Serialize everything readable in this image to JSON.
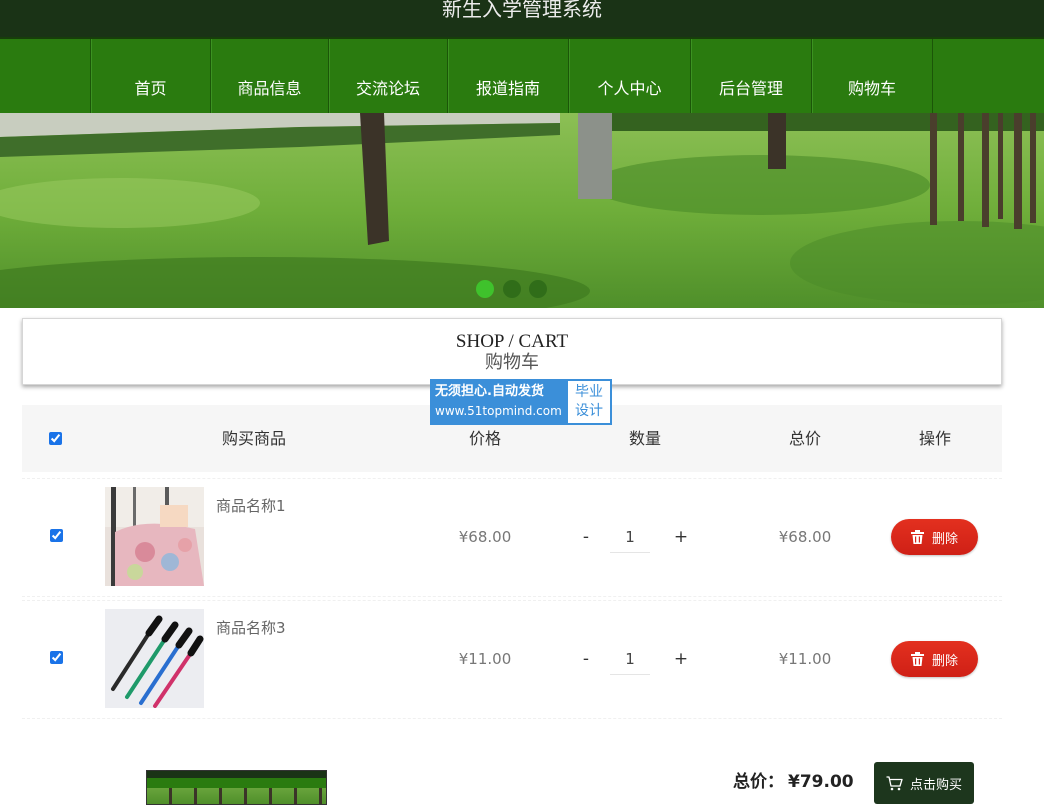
{
  "header": {
    "title": "新生入学管理系统"
  },
  "nav": {
    "items": [
      {
        "label": "首页"
      },
      {
        "label": "商品信息"
      },
      {
        "label": "交流论坛"
      },
      {
        "label": "报道指南"
      },
      {
        "label": "个人中心"
      },
      {
        "label": "后台管理"
      },
      {
        "label": "购物车"
      }
    ]
  },
  "banner": {
    "dot_count": 3,
    "active_dot": 0
  },
  "section": {
    "title_en": "SHOP / CART",
    "title_cn": "购物车"
  },
  "watermark": {
    "line1": "无须担心.自动发货",
    "line2": "www.51topmind.com",
    "badge_top": "毕业",
    "badge_bottom": "设计"
  },
  "table": {
    "select_all_checked": true,
    "headers": {
      "product": "购买商品",
      "price": "价格",
      "quantity": "数量",
      "total": "总价",
      "action": "操作"
    }
  },
  "items": [
    {
      "name": "商品名称1",
      "price": "¥68.00",
      "quantity": "1",
      "total": "¥68.00",
      "checked": true
    },
    {
      "name": "商品名称3",
      "price": "¥11.00",
      "quantity": "1",
      "total": "¥11.00",
      "checked": true
    }
  ],
  "controls": {
    "decrement": "-",
    "increment": "+",
    "delete_label": "删除"
  },
  "footer": {
    "total_label": "总价：",
    "total_value": "¥79.00",
    "buy_label": "点击购买"
  },
  "icons": {
    "delete": "trash-icon",
    "buy": "cart-icon"
  },
  "colors": {
    "header_bg": "#1a3316",
    "nav_bg": "#2a7b0f",
    "delete_button": "#d9261c",
    "buy_button": "#1d361d",
    "watermark_blue": "#3b8fd9"
  }
}
